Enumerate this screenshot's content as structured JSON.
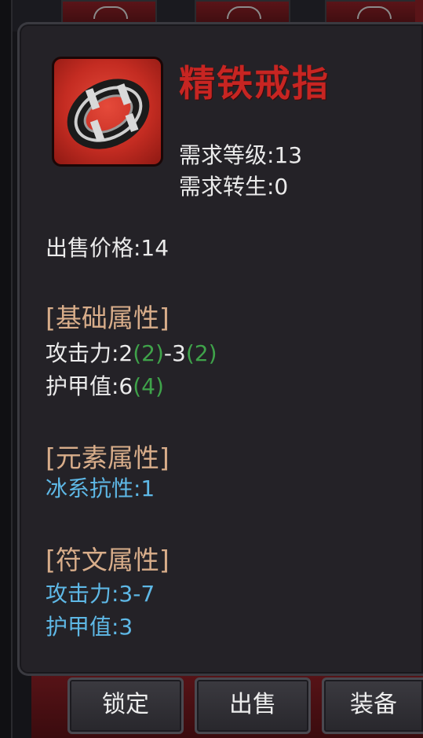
{
  "item": {
    "name": "精铁戒指",
    "req_level": "需求等级:13",
    "req_rebirth": "需求转生:0",
    "sell_price": "出售价格:14"
  },
  "base_attributes": {
    "header": "[基础属性]",
    "attack_label": "攻击力:2",
    "attack_bonus_min": "(2)",
    "attack_sep": "-3",
    "attack_bonus_max": "(2)",
    "armor_label": "护甲值:6",
    "armor_bonus": "(4)"
  },
  "element_attributes": {
    "header": "[元素属性]",
    "ice_resist": "冰系抗性:1"
  },
  "rune_attributes": {
    "header": "[符文属性]",
    "attack": "攻击力:3-7",
    "armor": "护甲值:3"
  },
  "buttons": {
    "lock": "锁定",
    "sell": "出售",
    "equip": "装备"
  },
  "colors": {
    "title_red": "#c72522",
    "header_tan": "#d8ad8a",
    "bonus_green": "#3fa34a",
    "rune_blue": "#5eb8e6"
  },
  "icon": "iron-ring-icon"
}
